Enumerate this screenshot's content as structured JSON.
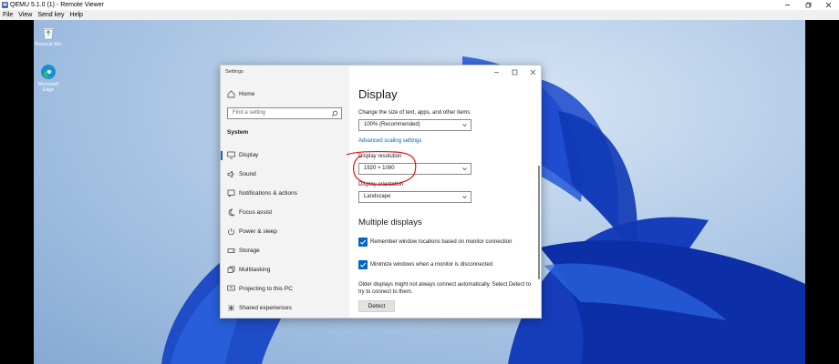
{
  "viewer": {
    "title": "QEMU 5.1.0 (1) - Remote Viewer",
    "menu": [
      "File",
      "View",
      "Send key",
      "Help"
    ]
  },
  "desktop_icons": [
    {
      "label": "Recycle Bin",
      "icon": "recycle-bin-icon"
    },
    {
      "label": "Microsoft Edge",
      "icon": "edge-icon"
    }
  ],
  "settings": {
    "window_title": "Settings",
    "home": "Home",
    "search_placeholder": "Find a setting",
    "section": "System",
    "nav": [
      {
        "label": "Display",
        "icon": "monitor-icon",
        "active": true
      },
      {
        "label": "Sound",
        "icon": "speaker-icon"
      },
      {
        "label": "Notifications & actions",
        "icon": "notification-icon"
      },
      {
        "label": "Focus assist",
        "icon": "moon-icon"
      },
      {
        "label": "Power & sleep",
        "icon": "power-icon"
      },
      {
        "label": "Storage",
        "icon": "storage-icon"
      },
      {
        "label": "Multitasking",
        "icon": "multitasking-icon"
      },
      {
        "label": "Projecting to this PC",
        "icon": "projecting-icon"
      },
      {
        "label": "Shared experiences",
        "icon": "shared-experiences-icon"
      }
    ],
    "content": {
      "heading": "Display",
      "scale_label": "Change the size of text, apps, and other items",
      "scale_value": "100% (Recommended)",
      "advanced_link": "Advanced scaling settings",
      "resolution_label": "Display resolution",
      "resolution_value": "1920 × 1080",
      "orientation_label": "Display orientation",
      "orientation_value": "Landscape",
      "multiple_heading": "Multiple displays",
      "checkbox1": "Remember window locations based on monitor connection",
      "checkbox2": "Minimize windows when a monitor is disconnected",
      "detect_note": "Older displays might not always connect automatically. Select Detect to try to connect to them.",
      "detect_button": "Detect"
    }
  },
  "colors": {
    "accent": "#0067c0",
    "annotation": "#e01010"
  }
}
